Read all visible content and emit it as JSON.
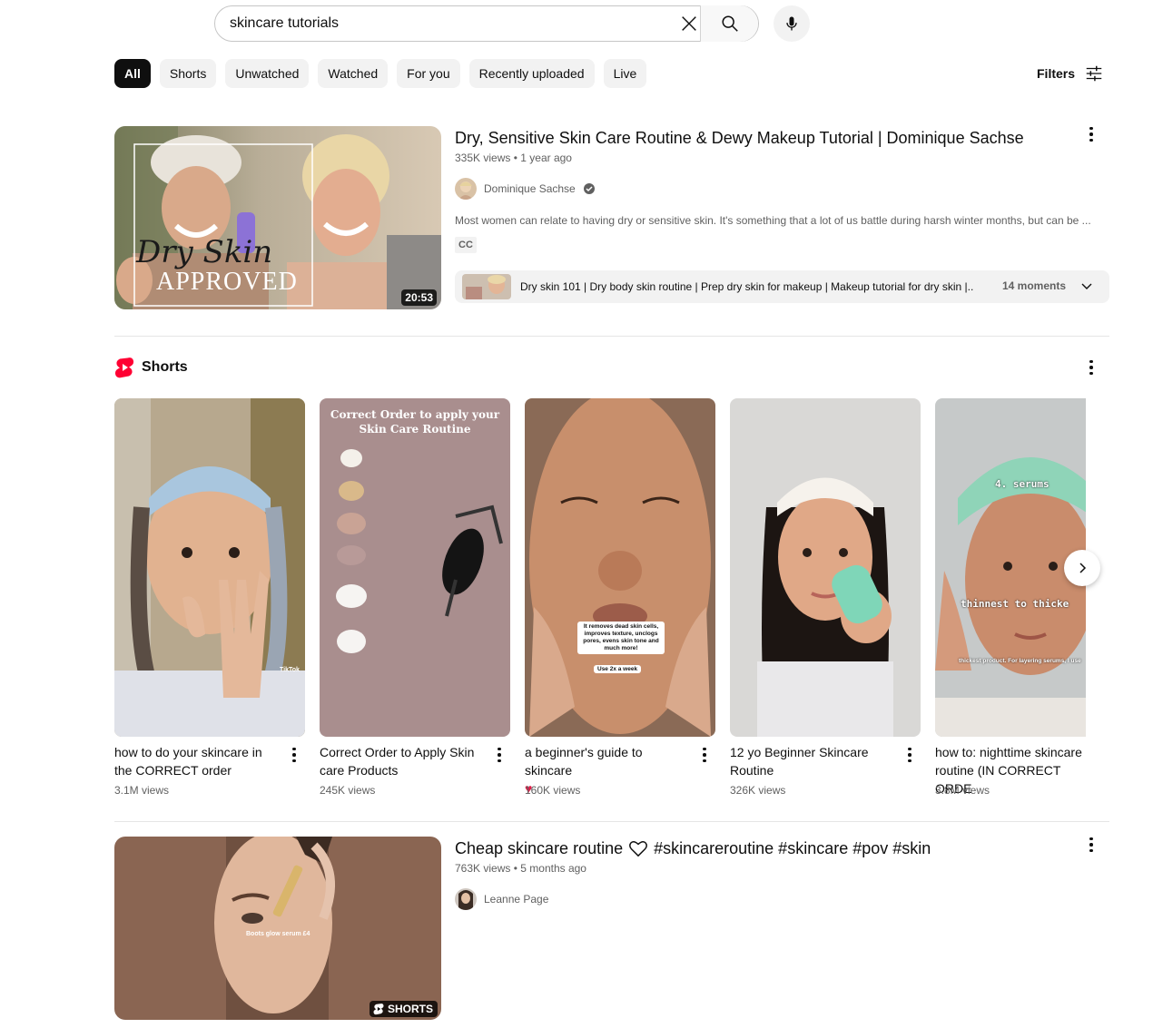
{
  "search": {
    "query": "skincare tutorials"
  },
  "chips": [
    "All",
    "Shorts",
    "Unwatched",
    "Watched",
    "For you",
    "Recently uploaded",
    "Live"
  ],
  "filters_label": "Filters",
  "video1": {
    "title": "Dry, Sensitive Skin Care Routine & Dewy Makeup Tutorial | Dominique Sachse",
    "views": "335K views",
    "age": "1 year ago",
    "channel": "Dominique Sachse",
    "verified": true,
    "description": "Most women can relate to having dry or sensitive skin. It's something that a lot of us battle during harsh winter months, but can be ...",
    "badge": "CC",
    "duration": "20:53",
    "thumb_text_script": "Dry Skin",
    "thumb_text_caps": "APPROVED",
    "moments_text": "Dry skin 101 | Dry body skin routine | Prep dry skin for makeup | Makeup tutorial for dry skin |...",
    "moments_count": "14 moments"
  },
  "shorts": {
    "heading": "Shorts",
    "items": [
      {
        "title": "how to do your skincare in the CORRECT order",
        "views": "3.1M views",
        "overlay": "TikTok"
      },
      {
        "title": "Correct Order to Apply Skin care Products",
        "views": "245K views",
        "overlay": "Correct Order to apply your Skin Care Routine"
      },
      {
        "title": "a beginner's guide to skincare",
        "views": "160K views",
        "overlay": "It removes dead skin cells, improves texture, unclogs pores, evens skin tone and much more!",
        "overlay2": "Use 2x a week"
      },
      {
        "title": "12 yo Beginner Skincare Routine",
        "views": "326K views"
      },
      {
        "title": "how to: nighttime skincare routine (IN CORRECT ORDE",
        "views": "3.8M views",
        "overlay": "4. serums",
        "overlay2": "thinnest to thicke",
        "overlay3": "thickest product. For layering serums, I use"
      }
    ]
  },
  "video2": {
    "title_part1": "Cheap skincare routine",
    "title_part2": "#skincareroutine #skincare #pov #skin",
    "views": "763K views",
    "age": "5 months ago",
    "channel": "Leanne Page",
    "badge": "SHORTS",
    "thumb_caption": "Boots glow serum £4"
  },
  "colors": {
    "accent": "#0f0f0f",
    "chip_bg": "#f2f2f2",
    "meta": "#606060",
    "shorts_red": "#ff0033"
  }
}
